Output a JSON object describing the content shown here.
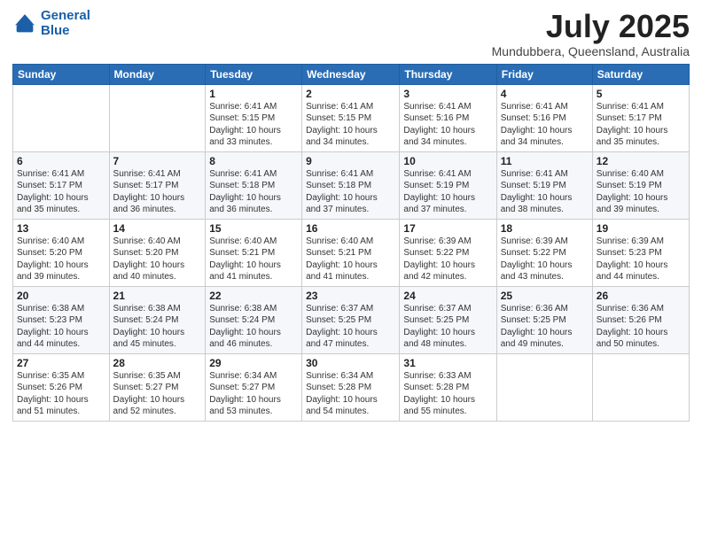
{
  "header": {
    "logo_line1": "General",
    "logo_line2": "Blue",
    "title": "July 2025",
    "subtitle": "Mundubbera, Queensland, Australia"
  },
  "days_of_week": [
    "Sunday",
    "Monday",
    "Tuesday",
    "Wednesday",
    "Thursday",
    "Friday",
    "Saturday"
  ],
  "weeks": [
    [
      {
        "day": "",
        "content": ""
      },
      {
        "day": "",
        "content": ""
      },
      {
        "day": "1",
        "content": "Sunrise: 6:41 AM\nSunset: 5:15 PM\nDaylight: 10 hours\nand 33 minutes."
      },
      {
        "day": "2",
        "content": "Sunrise: 6:41 AM\nSunset: 5:15 PM\nDaylight: 10 hours\nand 34 minutes."
      },
      {
        "day": "3",
        "content": "Sunrise: 6:41 AM\nSunset: 5:16 PM\nDaylight: 10 hours\nand 34 minutes."
      },
      {
        "day": "4",
        "content": "Sunrise: 6:41 AM\nSunset: 5:16 PM\nDaylight: 10 hours\nand 34 minutes."
      },
      {
        "day": "5",
        "content": "Sunrise: 6:41 AM\nSunset: 5:17 PM\nDaylight: 10 hours\nand 35 minutes."
      }
    ],
    [
      {
        "day": "6",
        "content": "Sunrise: 6:41 AM\nSunset: 5:17 PM\nDaylight: 10 hours\nand 35 minutes."
      },
      {
        "day": "7",
        "content": "Sunrise: 6:41 AM\nSunset: 5:17 PM\nDaylight: 10 hours\nand 36 minutes."
      },
      {
        "day": "8",
        "content": "Sunrise: 6:41 AM\nSunset: 5:18 PM\nDaylight: 10 hours\nand 36 minutes."
      },
      {
        "day": "9",
        "content": "Sunrise: 6:41 AM\nSunset: 5:18 PM\nDaylight: 10 hours\nand 37 minutes."
      },
      {
        "day": "10",
        "content": "Sunrise: 6:41 AM\nSunset: 5:19 PM\nDaylight: 10 hours\nand 37 minutes."
      },
      {
        "day": "11",
        "content": "Sunrise: 6:41 AM\nSunset: 5:19 PM\nDaylight: 10 hours\nand 38 minutes."
      },
      {
        "day": "12",
        "content": "Sunrise: 6:40 AM\nSunset: 5:19 PM\nDaylight: 10 hours\nand 39 minutes."
      }
    ],
    [
      {
        "day": "13",
        "content": "Sunrise: 6:40 AM\nSunset: 5:20 PM\nDaylight: 10 hours\nand 39 minutes."
      },
      {
        "day": "14",
        "content": "Sunrise: 6:40 AM\nSunset: 5:20 PM\nDaylight: 10 hours\nand 40 minutes."
      },
      {
        "day": "15",
        "content": "Sunrise: 6:40 AM\nSunset: 5:21 PM\nDaylight: 10 hours\nand 41 minutes."
      },
      {
        "day": "16",
        "content": "Sunrise: 6:40 AM\nSunset: 5:21 PM\nDaylight: 10 hours\nand 41 minutes."
      },
      {
        "day": "17",
        "content": "Sunrise: 6:39 AM\nSunset: 5:22 PM\nDaylight: 10 hours\nand 42 minutes."
      },
      {
        "day": "18",
        "content": "Sunrise: 6:39 AM\nSunset: 5:22 PM\nDaylight: 10 hours\nand 43 minutes."
      },
      {
        "day": "19",
        "content": "Sunrise: 6:39 AM\nSunset: 5:23 PM\nDaylight: 10 hours\nand 44 minutes."
      }
    ],
    [
      {
        "day": "20",
        "content": "Sunrise: 6:38 AM\nSunset: 5:23 PM\nDaylight: 10 hours\nand 44 minutes."
      },
      {
        "day": "21",
        "content": "Sunrise: 6:38 AM\nSunset: 5:24 PM\nDaylight: 10 hours\nand 45 minutes."
      },
      {
        "day": "22",
        "content": "Sunrise: 6:38 AM\nSunset: 5:24 PM\nDaylight: 10 hours\nand 46 minutes."
      },
      {
        "day": "23",
        "content": "Sunrise: 6:37 AM\nSunset: 5:25 PM\nDaylight: 10 hours\nand 47 minutes."
      },
      {
        "day": "24",
        "content": "Sunrise: 6:37 AM\nSunset: 5:25 PM\nDaylight: 10 hours\nand 48 minutes."
      },
      {
        "day": "25",
        "content": "Sunrise: 6:36 AM\nSunset: 5:25 PM\nDaylight: 10 hours\nand 49 minutes."
      },
      {
        "day": "26",
        "content": "Sunrise: 6:36 AM\nSunset: 5:26 PM\nDaylight: 10 hours\nand 50 minutes."
      }
    ],
    [
      {
        "day": "27",
        "content": "Sunrise: 6:35 AM\nSunset: 5:26 PM\nDaylight: 10 hours\nand 51 minutes."
      },
      {
        "day": "28",
        "content": "Sunrise: 6:35 AM\nSunset: 5:27 PM\nDaylight: 10 hours\nand 52 minutes."
      },
      {
        "day": "29",
        "content": "Sunrise: 6:34 AM\nSunset: 5:27 PM\nDaylight: 10 hours\nand 53 minutes."
      },
      {
        "day": "30",
        "content": "Sunrise: 6:34 AM\nSunset: 5:28 PM\nDaylight: 10 hours\nand 54 minutes."
      },
      {
        "day": "31",
        "content": "Sunrise: 6:33 AM\nSunset: 5:28 PM\nDaylight: 10 hours\nand 55 minutes."
      },
      {
        "day": "",
        "content": ""
      },
      {
        "day": "",
        "content": ""
      }
    ]
  ]
}
